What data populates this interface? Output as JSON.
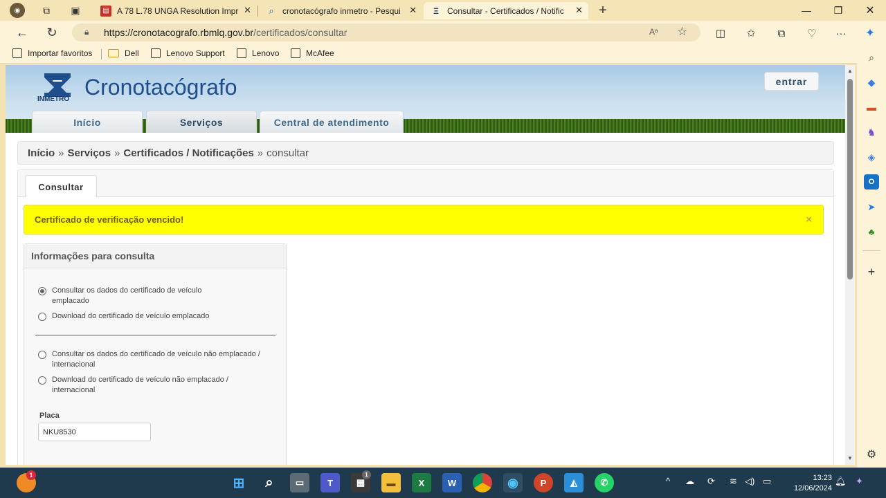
{
  "browser": {
    "tabs": [
      {
        "title": "A 78 L.78 UNGA Resolution Impr",
        "favicon": "pdf-icon"
      },
      {
        "title": "cronotacógrafo inmetro - Pesqui",
        "favicon": "search-icon"
      },
      {
        "title": "Consultar - Certificados / Notific",
        "favicon": "inmetro-icon",
        "active": true
      }
    ],
    "new_tab": "+",
    "url_host": "https://cronotacografo.rbmlq.gov.br",
    "url_path": "/certificados/consultar",
    "favorites": [
      "Importar favoritos",
      "Dell",
      "Lenovo Support",
      "Lenovo",
      "McAfee"
    ]
  },
  "site": {
    "logo_text": "INMETRO",
    "title": "Cronotacógrafo",
    "login_label": "entrar",
    "menu": [
      "Início",
      "Serviços",
      "Central de atendimento"
    ]
  },
  "breadcrumb": {
    "items": [
      "Início",
      "Serviços",
      "Certificados / Notificações"
    ],
    "current": "consultar",
    "separator": "»"
  },
  "content": {
    "tab_label": "Consultar",
    "alert": "Certificado de verificação vencido!",
    "alert_close": "×",
    "alert_color": "#ffff00",
    "panel_title": "Informações para consulta",
    "options": [
      {
        "label": "Consultar os dados do certificado de veículo emplacado",
        "selected": true
      },
      {
        "label": "Download do certificado de veículo emplacado",
        "selected": false
      },
      {
        "label": "Consultar os dados do certificado de veículo não emplacado / internacional",
        "selected": false
      },
      {
        "label": "Download do certificado de veículo não emplacado / internacional",
        "selected": false
      }
    ],
    "placa_label": "Placa",
    "placa_value": "NKU8530"
  },
  "taskbar": {
    "time": "13:23",
    "date": "12/06/2024",
    "weather_badge": "1",
    "teams_badge": "1"
  }
}
